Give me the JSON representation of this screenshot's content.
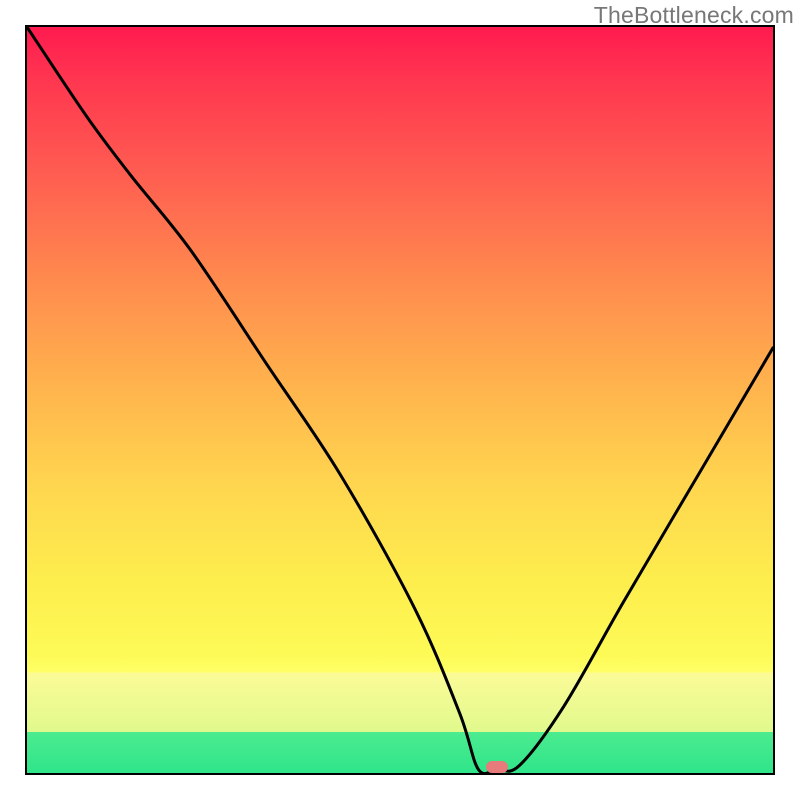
{
  "watermark": "TheBottleneck.com",
  "chart_data": {
    "type": "line",
    "title": "",
    "xlabel": "",
    "ylabel": "",
    "xlim": [
      0,
      100
    ],
    "ylim": [
      0,
      100
    ],
    "grid": false,
    "series": [
      {
        "name": "bottleneck-curve",
        "x": [
          0,
          8,
          14,
          22,
          32,
          42,
          52,
          58,
          60.5,
          63,
          66,
          72,
          80,
          90,
          100
        ],
        "y": [
          100,
          88,
          80,
          70,
          55,
          40,
          22,
          8,
          0.5,
          0.5,
          1,
          9,
          23,
          40,
          57
        ]
      }
    ],
    "annotations": [
      {
        "name": "minimum-marker",
        "x": 63,
        "y": 0.8,
        "shape": "pill",
        "color": "#E77A7A"
      }
    ],
    "background_gradient": {
      "type": "vertical",
      "stops": [
        {
          "pos": 0.0,
          "color": "#FF1A4F"
        },
        {
          "pos": 0.2,
          "color": "#FF5E51"
        },
        {
          "pos": 0.48,
          "color": "#FFB34D"
        },
        {
          "pos": 0.74,
          "color": "#FDED4D"
        },
        {
          "pos": 0.865,
          "color": "#FFFF66"
        },
        {
          "pos": 0.9,
          "color": "#F4FB90"
        },
        {
          "pos": 0.945,
          "color": "#4CEB8F"
        },
        {
          "pos": 1.0,
          "color": "#2FE58A"
        }
      ]
    }
  }
}
